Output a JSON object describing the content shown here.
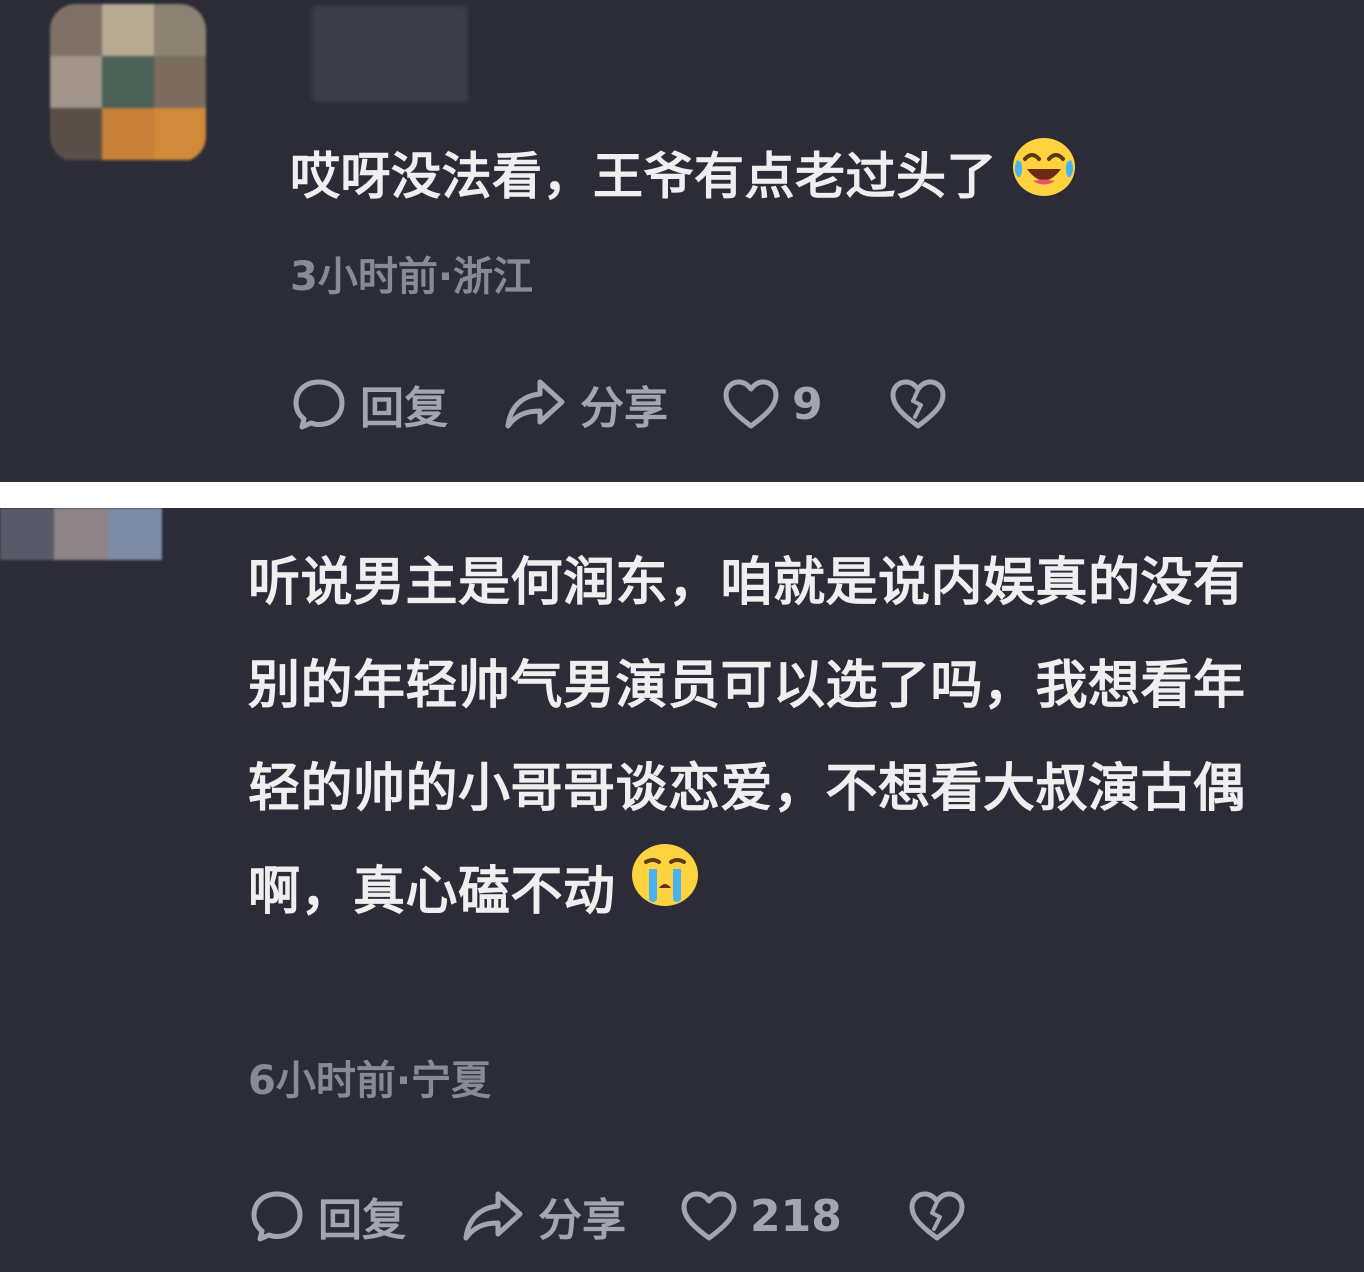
{
  "comments": [
    {
      "text": "哎呀没法看，王爷有点老过头了",
      "emoji": "laughing-crying-emoji",
      "meta": "3小时前·浙江",
      "actions": {
        "reply": "回复",
        "share": "分享",
        "likes": "9"
      },
      "avatar_colors": [
        "#7f7168",
        "#b6aa92",
        "#8c8273",
        "#a2958b",
        "#4d6258",
        "#7c6c60",
        "#5b4f49",
        "#c87f38",
        "#d08a3a"
      ],
      "name_blur_color": "#3d3e4a"
    },
    {
      "text": "听说男主是何润东，咱就是说内娱真的没有别的年轻帅气男演员可以选了吗，我想看年轻的帅的小哥哥谈恋爱，不想看大叔演古偶啊，真心磕不动",
      "emoji": "crying-emoji",
      "meta": "6小时前·宁夏",
      "actions": {
        "reply": "回复",
        "share": "分享",
        "likes": "218"
      },
      "avatar_colors": [
        "#595a68",
        "#8e8488",
        "#7c8aa4"
      ]
    }
  ],
  "colors": {
    "panel_bg": "#2b2c37",
    "separator": "#ffffff",
    "text": "#efeff2",
    "meta": "#898a95",
    "action": "#a4a5ae",
    "emoji_face": "#ffd23f"
  }
}
